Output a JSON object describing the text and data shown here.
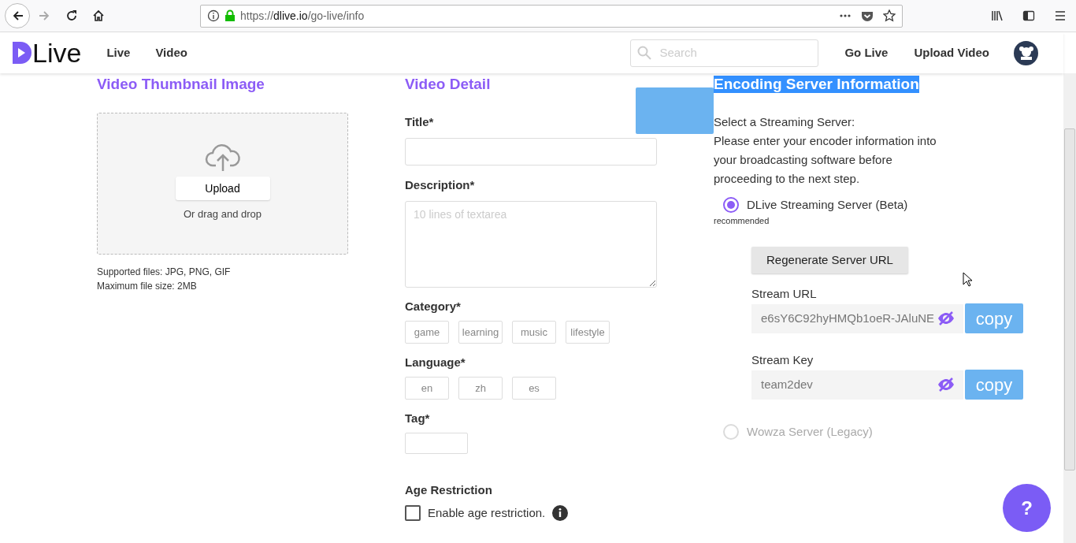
{
  "browser": {
    "nav_buttons": [
      {
        "kind": "back",
        "disabled": false
      },
      {
        "kind": "forward",
        "disabled": true
      },
      {
        "kind": "reload",
        "disabled": false
      },
      {
        "kind": "home",
        "disabled": false
      }
    ],
    "address": {
      "scheme": "https://",
      "host": "dlive.io",
      "path": "/go-live/info",
      "secure": true
    }
  },
  "site_header": {
    "logo": {
      "text": "Live"
    },
    "nav": [
      {
        "label": "Live"
      },
      {
        "label": "Video"
      }
    ],
    "search": {
      "placeholder": "Search"
    },
    "actions": [
      {
        "label": "Go Live"
      },
      {
        "label": "Upload Video"
      }
    ]
  },
  "thumbnail": {
    "heading": "Video Thumbnail Image",
    "upload_button": "Upload",
    "drop_hint": "Or drag and drop",
    "notes": [
      "Supported files: JPG, PNG, GIF",
      "Maximum file size: 2MB"
    ]
  },
  "video_detail": {
    "heading": "Video Detail",
    "title": {
      "label": "Title*"
    },
    "description": {
      "label": "Description*",
      "placeholder": "10 lines of textarea"
    },
    "category": {
      "label": "Category*",
      "options": [
        {
          "label": "game",
          "selected": false
        },
        {
          "label": "learning",
          "selected": false
        },
        {
          "label": "music",
          "selected": false
        },
        {
          "label": "lifestyle",
          "selected": false
        }
      ]
    },
    "language": {
      "label": "Language*",
      "options": [
        {
          "label": "en",
          "selected": false
        },
        {
          "label": "zh",
          "selected": false
        },
        {
          "label": "es",
          "selected": false
        }
      ]
    },
    "tag": {
      "label": "Tag*"
    },
    "age_restriction": {
      "label": "Age Restriction",
      "checkbox_label": "Enable age restriction.",
      "checked": false
    }
  },
  "encoding": {
    "heading": "Encoding Server Information",
    "heading_highlighted": true,
    "intro": [
      "Select a Streaming Server:",
      "Please enter your encoder information into",
      "your broadcasting software before",
      "proceeding to the next step."
    ],
    "servers": [
      {
        "label": "DLive Streaming Server (Beta)",
        "selected": true,
        "disabled": false,
        "note": "recommended"
      },
      {
        "label": "Wowza Server (Legacy)",
        "selected": false,
        "disabled": true
      }
    ],
    "regenerate_button": "Regenerate Server URL",
    "fields": [
      {
        "label": "Stream URL",
        "value": "e6sY6C92hyHMQb1oeR-JAluNE",
        "copy": "copy"
      },
      {
        "label": "Stream Key",
        "value": "team2dev",
        "copy": "copy"
      }
    ]
  },
  "help_button": {
    "label": "?"
  }
}
